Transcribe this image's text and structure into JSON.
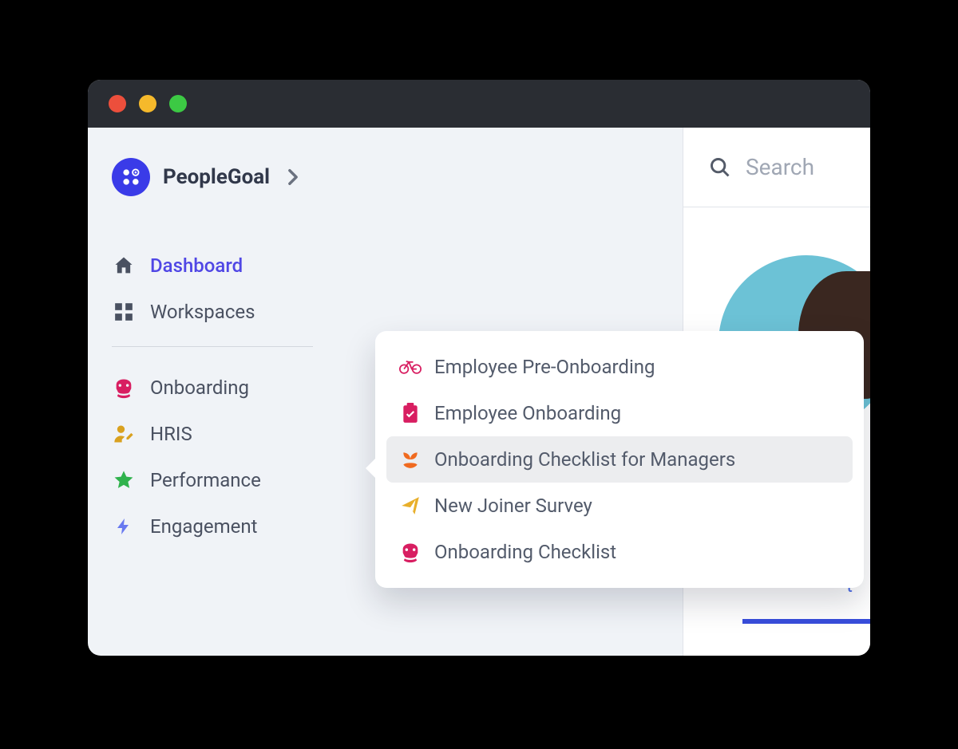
{
  "brand": {
    "name": "PeopleGoal"
  },
  "search": {
    "placeholder": "Search"
  },
  "nav": {
    "dashboard": "Dashboard",
    "workspaces": "Workspaces",
    "onboarding": "Onboarding",
    "hris": "HRIS",
    "performance": "Performance",
    "engagement": "Engagement"
  },
  "flyout": {
    "items": [
      {
        "label": "Employee Pre-Onboarding"
      },
      {
        "label": "Employee Onboarding"
      },
      {
        "label": "Onboarding Checklist for Managers"
      },
      {
        "label": "New Joiner Survey"
      },
      {
        "label": "Onboarding Checklist"
      }
    ]
  },
  "partial_link": "t"
}
